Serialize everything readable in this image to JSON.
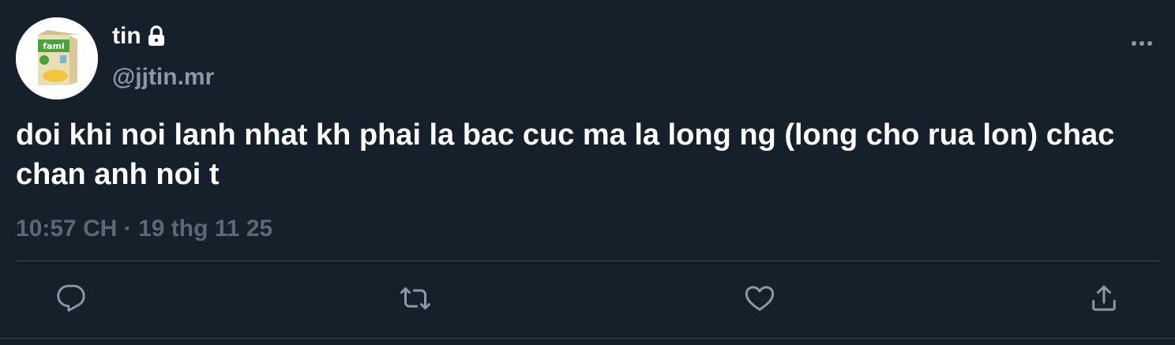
{
  "user": {
    "display_name": "tin",
    "handle": "@jjtin.mr",
    "avatar_icon": "fami-milk-carton-avatar",
    "avatar_text": "fami",
    "protected_icon": "lock-icon"
  },
  "tweet": {
    "text": "doi khi noi lanh nhat kh phai la bac cuc ma la long ng (long cho rua lon) chac chan anh noi t",
    "time": "10:57 CH",
    "separator": "·",
    "date": "19 thg 11 25"
  },
  "actions": {
    "reply_icon": "reply-icon",
    "retweet_icon": "retweet-icon",
    "like_icon": "heart-icon",
    "share_icon": "share-icon",
    "more_icon": "more-icon"
  },
  "colors": {
    "background": "#15202b",
    "primary_text": "#ffffff",
    "secondary_text": "#8b98a5",
    "muted_text": "#5b6875",
    "divider": "#38444d"
  }
}
